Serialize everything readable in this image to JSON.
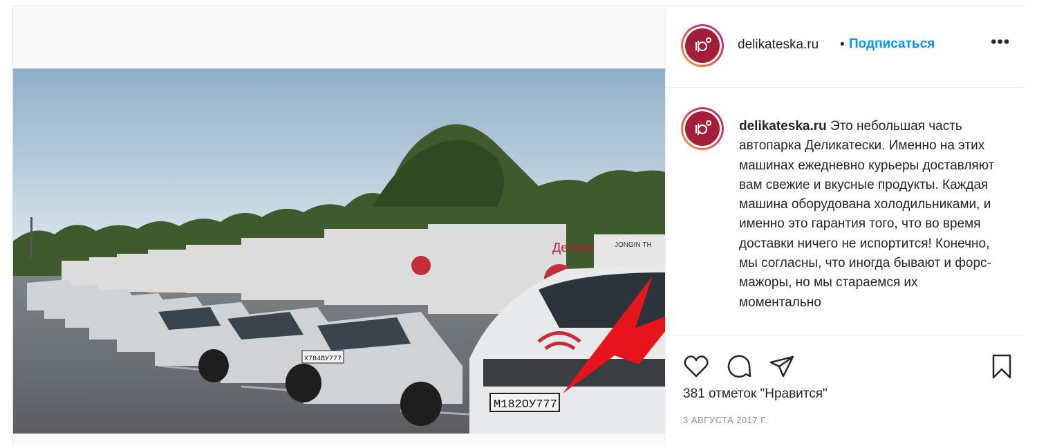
{
  "post": {
    "username": "delikateska.ru",
    "dot": "•",
    "follow_label": "Подписаться",
    "more_label": "•••",
    "caption_username": "delikateska.ru",
    "caption_text": "Это небольшая часть автопарка Деликатески. Именно на этих машинах ежедневно курьеры доставляют вам свежие и вкусные продукты. Каждая машина оборудована холодильниками, и именно это гарантия того, что во время доставки ничего не испортится! Конечно, мы согласны, что иногда бывают и форс-мажоры, но мы стараемся их моментально",
    "likes_text": "381 отметок \"Нравится\"",
    "date_text": "3 АВГУСТА 2017 Г."
  },
  "photo": {
    "van_brand_text": "Делика",
    "plate_front": "М182ОУ777",
    "plate_second": "Х784ВУ777",
    "refrigerator_brand": "JONGIN TH"
  },
  "icons": {
    "like": "heart-icon",
    "comment": "comment-icon",
    "share": "paper-plane-icon",
    "save": "bookmark-icon",
    "more": "more-options-icon"
  },
  "colors": {
    "brand_red": "#a41e3a",
    "follow_blue": "#0095f6",
    "arrow_red": "#e8141c"
  }
}
